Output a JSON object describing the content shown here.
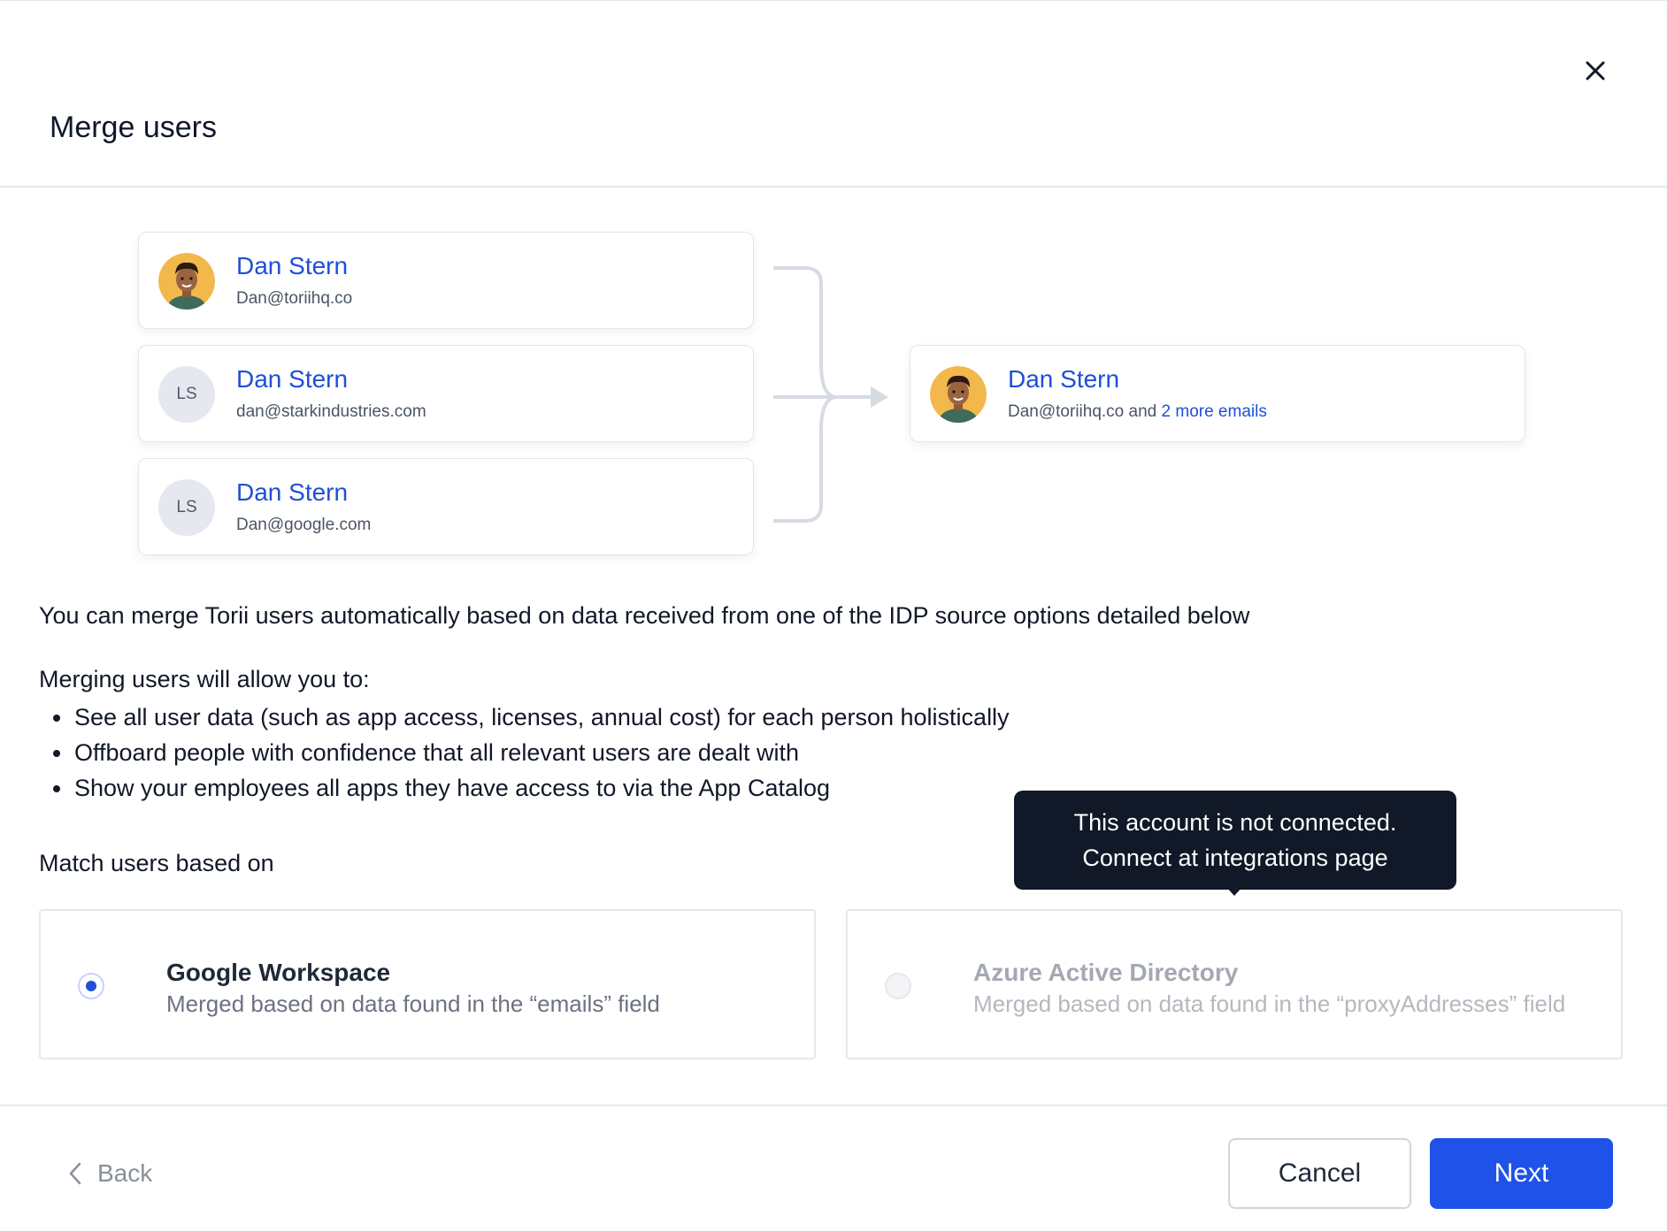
{
  "dialog": {
    "title": "Merge users"
  },
  "users": [
    {
      "name": "Dan Stern",
      "email": "Dan@toriihq.co",
      "avatar": "photo"
    },
    {
      "name": "Dan Stern",
      "email": "dan@starkindustries.com",
      "avatar": "LS"
    },
    {
      "name": "Dan Stern",
      "email": "Dan@google.com",
      "avatar": "LS"
    }
  ],
  "merged_user": {
    "name": "Dan Stern",
    "email": "Dan@toriihq.co",
    "email_joiner": " and ",
    "more_emails_link": "2 more emails"
  },
  "intro_text": "You can merge Torii users automatically based on data received from one of the IDP source options detailed below",
  "benefits": {
    "title": "Merging users will allow you to:",
    "items": [
      "See all user data (such as app access, licenses, annual cost) for each person holistically",
      "Offboard people with confidence that all relevant users are dealt with",
      "Show your employees all apps they have access to via the App Catalog"
    ]
  },
  "match": {
    "label": "Match users based on",
    "options": [
      {
        "title": "Google Workspace",
        "description": "Merged based on data found in the “emails” field",
        "selected": true,
        "disabled": false
      },
      {
        "title": "Azure Active Directory",
        "description": "Merged based on data found in the “proxyAddresses” field",
        "selected": false,
        "disabled": true
      }
    ]
  },
  "tooltip": {
    "line1": "This account is not connected.",
    "line2": "Connect at integrations page"
  },
  "footer": {
    "back_label": "Back",
    "cancel_label": "Cancel",
    "next_label": "Next"
  },
  "colors": {
    "accent": "#1e52e8",
    "link": "#1f4fd8",
    "tooltip_bg": "#111827"
  },
  "icons": {
    "close": "close-icon",
    "back": "chevron-left-icon",
    "arrow": "arrow-right-icon"
  }
}
